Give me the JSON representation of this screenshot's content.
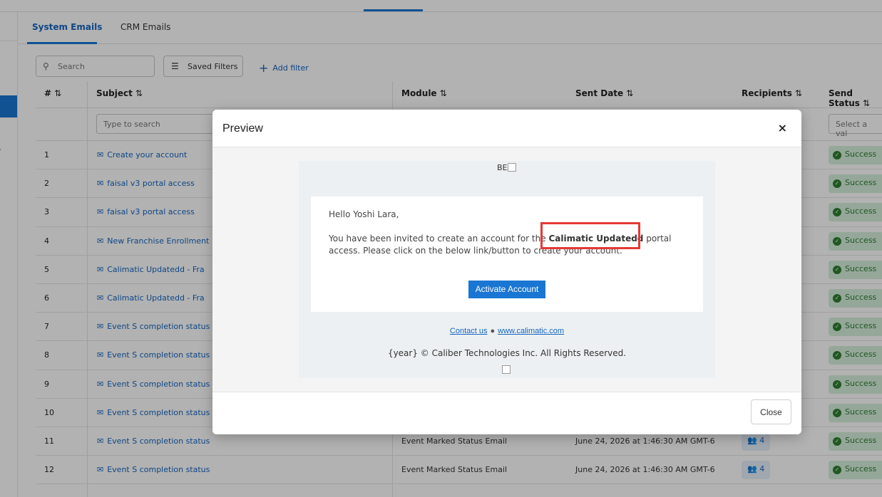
{
  "tabs": [
    {
      "label": "System Emails",
      "active": true
    },
    {
      "label": "CRM Emails",
      "active": false
    }
  ],
  "toolbar": {
    "search_placeholder": "Search",
    "saved_filters_label": "Saved Filters",
    "add_filter_label": "Add filter"
  },
  "table": {
    "headers": {
      "num": "#",
      "subject": "Subject",
      "module": "Module",
      "sent_date": "Sent Date",
      "recipients": "Recipients",
      "send_status": "Send Status"
    },
    "subject_filter_placeholder": "Type to search",
    "status_filter_placeholder": "Select a val",
    "rows": [
      {
        "num": "1",
        "subject": "Create your account",
        "module": "",
        "date": "",
        "recipients": "",
        "status": "Success"
      },
      {
        "num": "2",
        "subject": "faisal v3 portal access",
        "module": "",
        "date": "",
        "recipients": "",
        "status": "Success"
      },
      {
        "num": "3",
        "subject": "faisal v3 portal access",
        "module": "",
        "date": "",
        "recipients": "",
        "status": "Success"
      },
      {
        "num": "4",
        "subject": "New Franchise Enrollment",
        "module": "",
        "date": "",
        "recipients": "",
        "status": "Success"
      },
      {
        "num": "5",
        "subject": "Calimatic Updatedd - Fra",
        "module": "",
        "date": "",
        "recipients": "",
        "status": "Success"
      },
      {
        "num": "6",
        "subject": "Calimatic Updatedd - Fra",
        "module": "",
        "date": "",
        "recipients": "",
        "status": "Success"
      },
      {
        "num": "7",
        "subject": "Event S completion status",
        "module": "",
        "date": "",
        "recipients": "",
        "status": "Success"
      },
      {
        "num": "8",
        "subject": "Event S completion status",
        "module": "",
        "date": "",
        "recipients": "",
        "status": "Success"
      },
      {
        "num": "9",
        "subject": "Event S completion status",
        "module": "",
        "date": "",
        "recipients": "",
        "status": "Success"
      },
      {
        "num": "10",
        "subject": "Event S completion status",
        "module": "",
        "date": "",
        "recipients": "",
        "status": "Success"
      },
      {
        "num": "11",
        "subject": "Event S completion status",
        "module": "Event Marked Status Email",
        "date": "June 24, 2026 at 1:46:30 AM GMT-6",
        "recipients": "4",
        "status": "Success"
      },
      {
        "num": "12",
        "subject": "Event S completion status",
        "module": "Event Marked Status Email",
        "date": "June 24, 2026 at 1:46:30 AM GMT-6",
        "recipients": "4",
        "status": "Success"
      }
    ]
  },
  "modal": {
    "title": "Preview",
    "close_icon": "×",
    "close_button": "Close",
    "email": {
      "logo_alt": "BE",
      "greeting": "Hello Yoshi Lara,",
      "invite_before": "You have been invited to create an account for the ",
      "company_name": "Calimatic Updatedd",
      "invite_after": " portal access. Please click on the below link/button to create your account.",
      "activate_button": "Activate Account",
      "contact_link": "Contact us",
      "separator": "●",
      "website_link": "www.calimatic.com",
      "copyright": "{year} © Caliber Technologies Inc. All Rights Reserved."
    }
  },
  "colors": {
    "accent": "#1976d2",
    "success": "#2e7d32",
    "highlight": "#e53935"
  }
}
